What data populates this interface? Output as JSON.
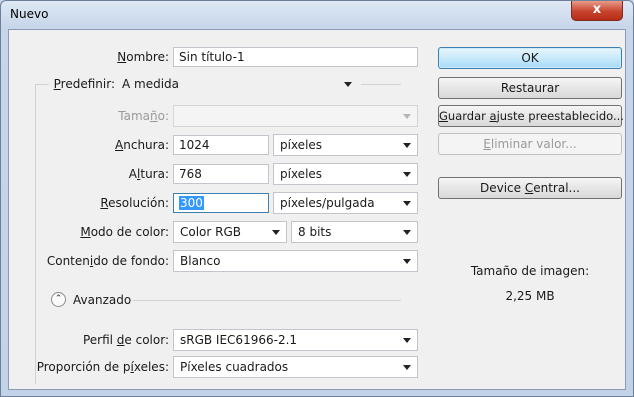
{
  "window": {
    "title": "Nuevo",
    "close_glyph": "x"
  },
  "form": {
    "nombre": {
      "label_pre": "",
      "label_key": "N",
      "label_post": "ombre:",
      "value": "Sin título-1"
    },
    "predefinir": {
      "label_pre": "",
      "label_key": "P",
      "label_post": "redefinir:",
      "value": "A medida"
    },
    "tamano": {
      "label_pre": "Tama",
      "label_key": "ñ",
      "label_post": "o:",
      "value": ""
    },
    "anchura": {
      "label_pre": "",
      "label_key": "A",
      "label_post": "nchura:",
      "value": "1024",
      "unit": "píxeles"
    },
    "altura": {
      "label_pre": "A",
      "label_key": "l",
      "label_post": "tura:",
      "value": "768",
      "unit": "píxeles"
    },
    "resolucion": {
      "label_pre": "",
      "label_key": "R",
      "label_post": "esolución:",
      "value": "300",
      "unit": "píxeles/pulgada"
    },
    "modo": {
      "label_pre": "",
      "label_key": "M",
      "label_post": "odo de color:",
      "value": "Color RGB",
      "bits": "8 bits"
    },
    "contenido": {
      "label_pre": "Conten",
      "label_key": "i",
      "label_post": "do de fondo:",
      "value": "Blanco"
    },
    "avanzado": {
      "label": "Avanzado",
      "icon": "collapse-icon",
      "glyph": "⌃"
    },
    "perfil": {
      "label_pre": "Perfil ",
      "label_key": "d",
      "label_post": "e color:",
      "value": "sRGB IEC61966-2.1"
    },
    "proporcion": {
      "label_pre": "Proporción de p",
      "label_key": "í",
      "label_post": "xeles:",
      "value": "Píxeles cuadrados"
    }
  },
  "buttons": {
    "ok": "OK",
    "restaurar": "Restaurar",
    "guardar": {
      "pre": "",
      "key": "G",
      "mid": "uardar ",
      "key2": "a",
      "post": "juste preestablecido..."
    },
    "eliminar": {
      "pre": "",
      "key": "E",
      "post": "liminar valor..."
    },
    "device": {
      "pre": "Device ",
      "key": "C",
      "post": "entral..."
    }
  },
  "info": {
    "label": "Tamaño de imagen:",
    "value": "2,25 MB"
  }
}
